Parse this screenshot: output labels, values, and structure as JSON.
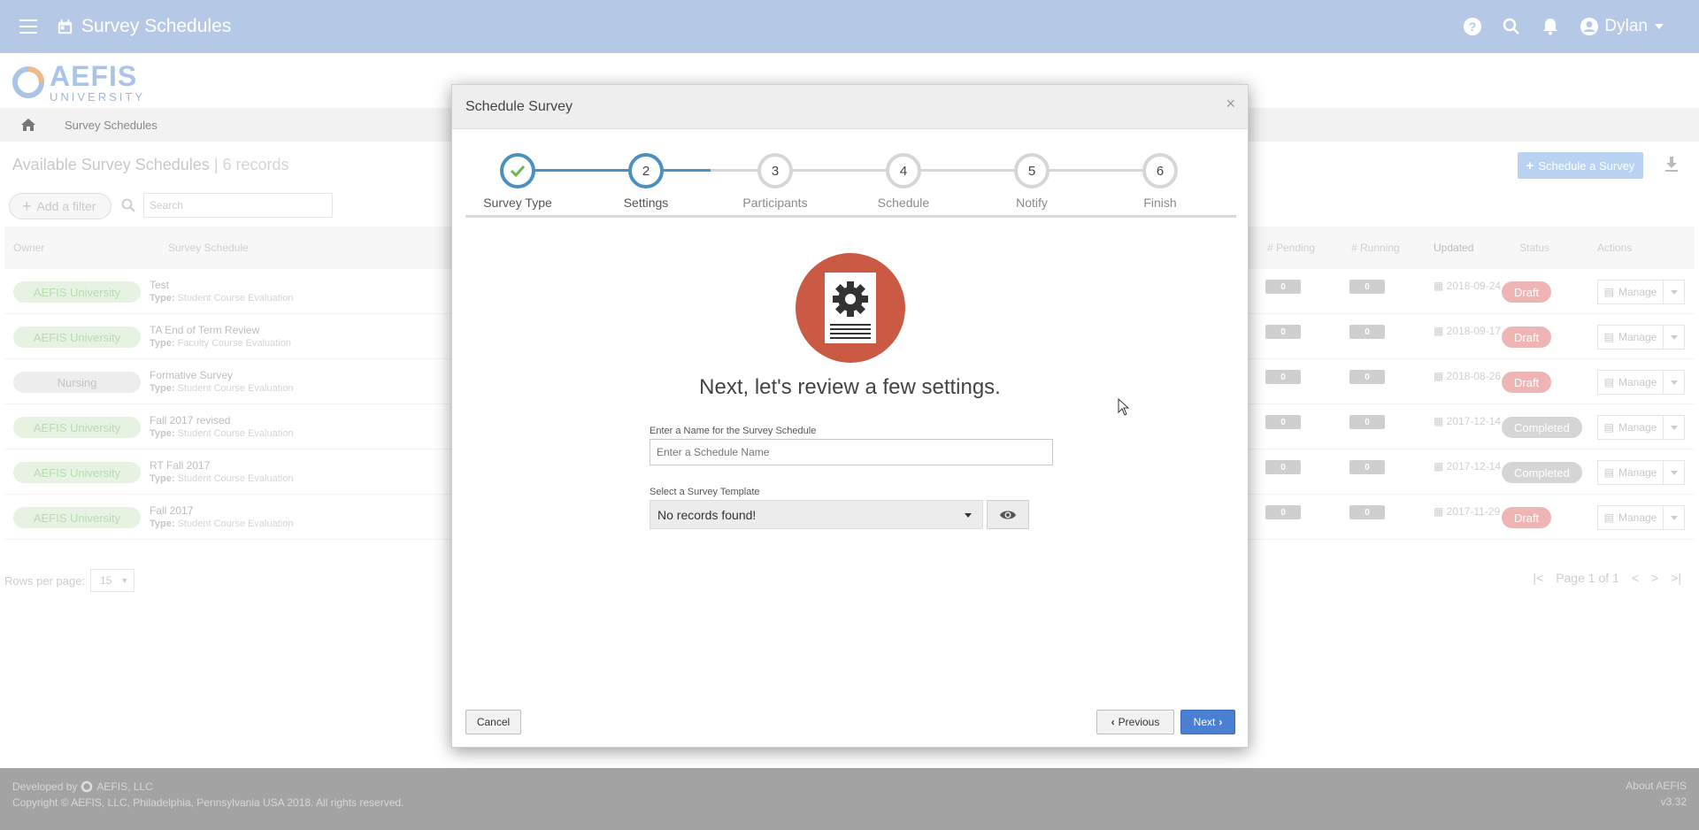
{
  "topbar": {
    "title": "Survey Schedules",
    "user": "Dylan",
    "icons": [
      "menu-icon",
      "calendar-icon",
      "help-icon",
      "search-icon",
      "bell-icon",
      "account-icon"
    ]
  },
  "logo": {
    "word1": "AEFIS",
    "word2": "UNIVERSITY"
  },
  "breadcrumb": {
    "current": "Survey Schedules"
  },
  "list": {
    "title": "Available Survey Schedules",
    "count": "| 6 records",
    "add_filter": "Add a filter",
    "search_placeholder": "Search",
    "schedule_button": "Schedule a Survey",
    "columns": [
      "Owner",
      "Survey Schedule",
      "# Pending",
      "# Running",
      "Updated",
      "Status",
      "Actions"
    ],
    "type_label": "Type:",
    "manage_label": "Manage",
    "rows": [
      {
        "owner": "AEFIS University",
        "name": "Test",
        "type": "Student Course Evaluation",
        "pending": "0",
        "running": "0",
        "updated": "2018-09-24",
        "status": "Draft"
      },
      {
        "owner": "AEFIS University",
        "name": "TA End of Term Review",
        "type": "Faculty Course Evaluation",
        "pending": "0",
        "running": "0",
        "updated": "2018-09-17",
        "status": "Draft"
      },
      {
        "owner": "Nursing",
        "name": "Formative Survey",
        "type": "Student Course Evaluation",
        "pending": "0",
        "running": "0",
        "updated": "2018-08-26",
        "status": "Draft"
      },
      {
        "owner": "AEFIS University",
        "name": "Fall 2017 revised",
        "type": "Student Course Evaluation",
        "pending": "0",
        "running": "0",
        "updated": "2017-12-14",
        "status": "Completed"
      },
      {
        "owner": "AEFIS University",
        "name": "RT Fall 2017",
        "type": "Student Course Evaluation",
        "pending": "0",
        "running": "0",
        "updated": "2017-12-14",
        "status": "Completed"
      },
      {
        "owner": "AEFIS University",
        "name": "Fall 2017",
        "type": "Student Course Evaluation",
        "pending": "0",
        "running": "0",
        "updated": "2017-11-29",
        "status": "Draft"
      }
    ],
    "rows_per_page_label": "Rows per page:",
    "rows_per_page_value": "15",
    "pager_text": "Page 1 of 1"
  },
  "footer": {
    "developed_by": "Developed by",
    "company": "AEFIS, LLC",
    "copyright": "Copyright © AEFIS, LLC, Philadelphia, Pennsylvania USA 2018. All rights reserved.",
    "about": "About AEFIS",
    "version": "v3.32"
  },
  "modal": {
    "title": "Schedule Survey",
    "close": "×",
    "steps": [
      {
        "num": "",
        "label": "Survey Type",
        "state": "done"
      },
      {
        "num": "2",
        "label": "Settings",
        "state": "active"
      },
      {
        "num": "3",
        "label": "Participants",
        "state": "pending"
      },
      {
        "num": "4",
        "label": "Schedule",
        "state": "pending"
      },
      {
        "num": "5",
        "label": "Notify",
        "state": "pending"
      },
      {
        "num": "6",
        "label": "Finish",
        "state": "pending"
      }
    ],
    "headline": "Next, let's review a few settings.",
    "name_label": "Enter a Name for the Survey Schedule",
    "name_placeholder": "Enter a Schedule Name",
    "template_label": "Select a Survey Template",
    "template_value": "No records found!",
    "cancel": "Cancel",
    "previous": "Previous",
    "next": "Next"
  },
  "colors": {
    "topbar": "#b5c9e6",
    "accent": "#4a90c0",
    "next_button": "#4a7fd1",
    "hero": "#cb5a44",
    "check": "#6bb84a"
  }
}
